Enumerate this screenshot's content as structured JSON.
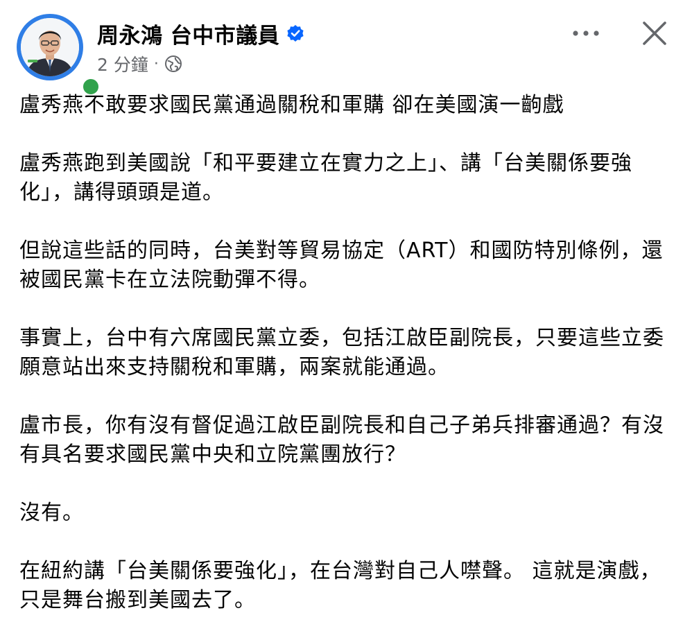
{
  "post": {
    "author": "周永鴻 台中市議員",
    "time": "2 分鐘",
    "separator": "·",
    "audience_icon": "globe-icon",
    "verified_icon": "verified-badge-icon",
    "menu_icon": "more-horizontal-icon",
    "close_icon": "close-icon",
    "online": true,
    "paragraphs": [
      "盧秀燕不敢要求國民黨通過關稅和軍購 卻在美國演一齣戲",
      "盧秀燕跑到美國說「和平要建立在實力之上」、講「台美關係要強化」，講得頭頭是道。",
      "但說這些話的同時，台美對等貿易協定（ART）和國防特別條例，還被國民黨卡在立法院動彈不得。",
      "事實上，台中有六席國民黨立委，包括江啟臣副院長，只要這些立委願意站出來支持關稅和軍購，兩案就能通過。",
      "盧市長，你有沒有督促過江啟臣副院長和自己子弟兵排審通過？有沒有具名要求國民黨中央和立院黨團放行？",
      "沒有。",
      "在紐約講「台美關係要強化」，在台灣對自己人噤聲。 這就是演戲，只是舞台搬到美國去了。"
    ]
  },
  "colors": {
    "text": "#050505",
    "secondary": "#65676b",
    "verified": "#0866ff",
    "online": "#31a24c",
    "avatar_ring": "#2f7ee6"
  }
}
